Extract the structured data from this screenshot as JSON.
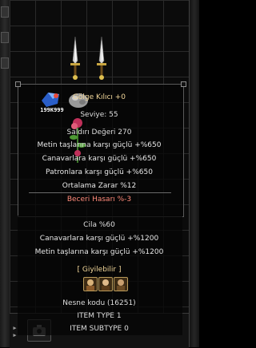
{
  "inventory": {
    "stack_count": "199K999",
    "icons": [
      "sword-icon",
      "sword-icon",
      "gem-item-icon",
      "ore-item-icon",
      "flower-item-icon",
      "bag-icon"
    ]
  },
  "tooltip": {
    "item_name": "Gölge Kılıcı +0",
    "level": "Seviye: 55",
    "attack": "Saldırı Değeri 270",
    "bonus_1": "Metin taşlarına karşı güçlü +%650",
    "bonus_2": "Canavarlara karşı güçlü +%650",
    "bonus_3": "Patronlara karşı güçlü +%650",
    "avg_damage": "Ortalama Zarar %12",
    "skill_damage": "Beceri Hasarı %-3",
    "polish": "Cila %60",
    "polish_bonus_1": "Canavarlara karşı güçlü +%1200",
    "polish_bonus_2": "Metin taşlarına karşı güçlü +%1200",
    "wearable": "[ Giyilebilir ]",
    "item_code": "Nesne kodu (16251)",
    "item_type": "ITEM TYPE 1",
    "item_subtype": "ITEM SUBTYPE 0"
  },
  "colors": {
    "name": "#f2d79a",
    "bonus": "#e8e8e8",
    "negative": "#ff8a7a"
  }
}
